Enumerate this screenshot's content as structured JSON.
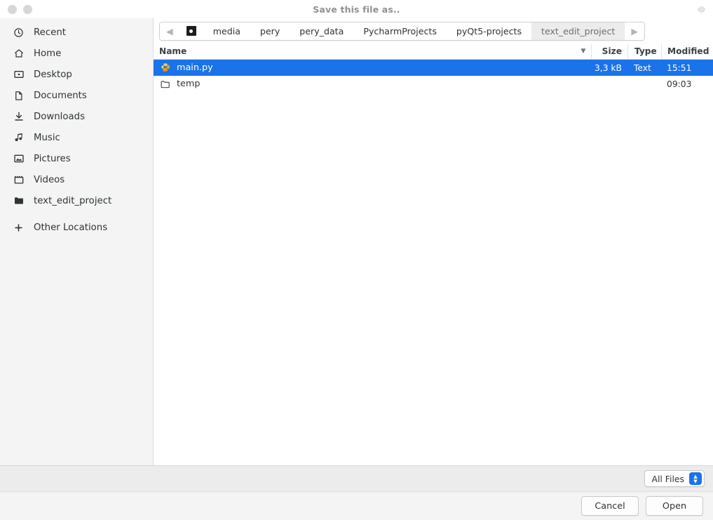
{
  "window": {
    "title": "Save this file as..",
    "controls": [
      "minimize",
      "maximize"
    ],
    "gear_icon": "gear-icon"
  },
  "sidebar": {
    "items": [
      {
        "label": "Recent",
        "icon": "clock-icon"
      },
      {
        "label": "Home",
        "icon": "home-icon"
      },
      {
        "label": "Desktop",
        "icon": "desktop-icon"
      },
      {
        "label": "Documents",
        "icon": "document-icon"
      },
      {
        "label": "Downloads",
        "icon": "download-icon"
      },
      {
        "label": "Music",
        "icon": "music-note-icon"
      },
      {
        "label": "Pictures",
        "icon": "picture-icon"
      },
      {
        "label": "Videos",
        "icon": "video-icon"
      },
      {
        "label": "text_edit_project",
        "icon": "folder-icon"
      },
      {
        "label": "Other Locations",
        "icon": "plus-icon"
      }
    ]
  },
  "pathbar": {
    "back_arrow": "◀",
    "forward_arrow": "▶",
    "device_icon": "disk-icon",
    "crumbs": [
      {
        "label": "media",
        "active": false
      },
      {
        "label": "pery",
        "active": false
      },
      {
        "label": "pery_data",
        "active": false
      },
      {
        "label": "PycharmProjects",
        "active": false
      },
      {
        "label": "pyQt5-projects",
        "active": false
      },
      {
        "label": "text_edit_project",
        "active": true
      }
    ]
  },
  "filelist": {
    "columns": {
      "name": "Name",
      "size": "Size",
      "type": "Type",
      "modified": "Modified",
      "sort_indicator": "▼"
    },
    "rows": [
      {
        "name": "main.py",
        "size": "3,3 kB",
        "type": "Text",
        "modified": "15:51",
        "icon": "python-file-icon",
        "selected": true
      },
      {
        "name": "temp",
        "size": "",
        "type": "",
        "modified": "09:03",
        "icon": "folder-icon",
        "selected": false
      }
    ]
  },
  "filter": {
    "selected": "All Files",
    "arrows_icon": "chevron-up-down-icon"
  },
  "footer": {
    "cancel_label": "Cancel",
    "open_label": "Open"
  },
  "colors": {
    "selection_blue": "#1a73e8",
    "sidebar_bg": "#f4f4f4",
    "filterbar_bg": "#ececec",
    "footer_bg": "#f4f4f4",
    "title_text": "#8e9194"
  }
}
